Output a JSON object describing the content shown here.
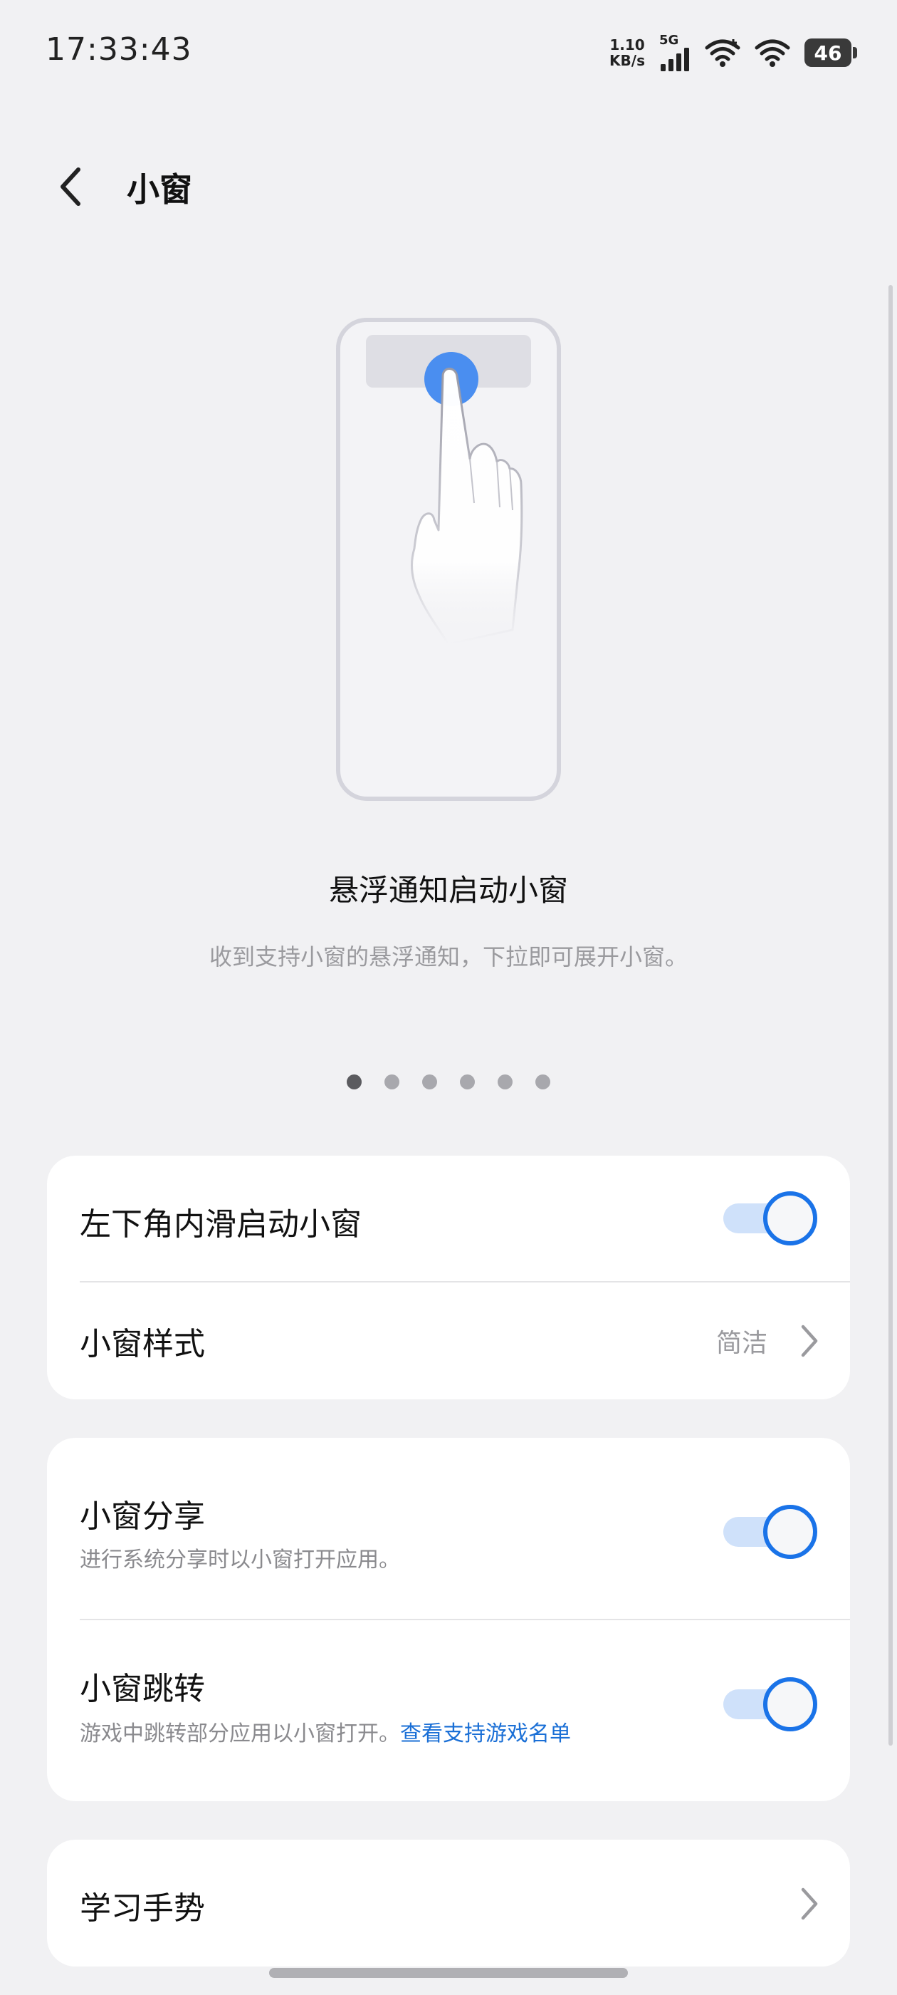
{
  "status_bar": {
    "time": "17:33:43",
    "net_speed_value": "1.10",
    "net_speed_unit": "KB/s",
    "signal_label": "5G",
    "battery": "46"
  },
  "header": {
    "title": "小窗",
    "back_icon": "chevron-left-icon"
  },
  "feature_slide": {
    "title": "悬浮通知启动小窗",
    "description": "收到支持小窗的悬浮通知，下拉即可展开小窗。",
    "page_count": 6,
    "active_page": 1
  },
  "settings": {
    "group1": {
      "corner_swipe": {
        "label": "左下角内滑启动小窗",
        "enabled": true
      },
      "window_style": {
        "label": "小窗样式",
        "value": "简洁"
      }
    },
    "group2": {
      "share": {
        "label": "小窗分享",
        "description": "进行系统分享时以小窗打开应用。",
        "enabled": true
      },
      "jump": {
        "label": "小窗跳转",
        "description": "游戏中跳转部分应用以小窗打开。",
        "link": "查看支持游戏名单",
        "enabled": true
      }
    },
    "group3": {
      "learn_gesture": {
        "label": "学习手势"
      }
    }
  },
  "colors": {
    "accent": "#1a73e8",
    "toggle_track": "#cfe1fa",
    "background": "#f1f1f3",
    "link": "#1a6fd6"
  }
}
